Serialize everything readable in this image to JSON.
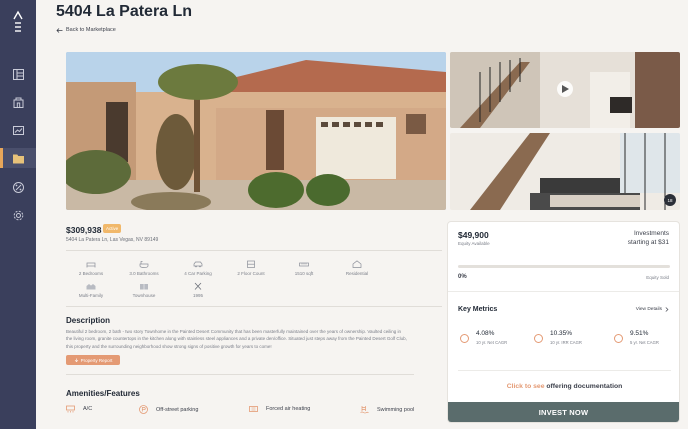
{
  "header": {
    "title": "5404 La Patera Ln",
    "back_label": "Back to Marketplace"
  },
  "sidebar": {
    "items": [
      {
        "icon": "layout-icon"
      },
      {
        "icon": "building-icon"
      },
      {
        "icon": "chart-icon"
      },
      {
        "icon": "folder-icon",
        "active": true
      },
      {
        "icon": "percent-icon"
      },
      {
        "icon": "gear-icon"
      }
    ]
  },
  "gallery": {
    "photo_count": "18"
  },
  "listing": {
    "price": "$309,938",
    "status": "Active",
    "address": "5404 La Patera Ln, Las Vegas, NV 89149",
    "features": [
      {
        "icon": "bed-icon",
        "label": "2 Bedrooms"
      },
      {
        "icon": "bath-icon",
        "label": "3.0 Bathrooms"
      },
      {
        "icon": "car-icon",
        "label": "4 Car Parking"
      },
      {
        "icon": "floor-icon",
        "label": "2 Floor Count"
      },
      {
        "icon": "ruler-icon",
        "label": "1510 sqft"
      },
      {
        "icon": "home-icon",
        "label": "Residential"
      },
      {
        "icon": "multifamily-icon",
        "label": "Multi-Family"
      },
      {
        "icon": "townhouse-icon",
        "label": "Townhouse"
      },
      {
        "icon": "hammer-icon",
        "label": "1995"
      }
    ]
  },
  "description": {
    "title": "Description",
    "text": "Beautiful 2 bedroom, 2 bath - two story Townhome in the Painted Desert Community that has been masterfully maintained over the years of ownership. Vaulted ceiling in the living room, granite countertops in the kitchen along with stainless steel appliances and a private den/office. Situated just steps away from the Painted Desert Golf Club, this property and the surrounding neighborhood show strong signs of positive growth for years to come!",
    "report_label": "Property Report"
  },
  "amenities": {
    "title": "Amenities/Features",
    "items": [
      {
        "icon": "ac-icon",
        "label": "A/C"
      },
      {
        "icon": "parking-icon",
        "label": "Off-street parking"
      },
      {
        "icon": "heater-icon",
        "label": "Forced air heating"
      },
      {
        "icon": "pool-icon",
        "label": "Swimming pool"
      }
    ]
  },
  "investment": {
    "equity_amount": "$49,900",
    "equity_label": "Equity Available",
    "investments_label": "Investments",
    "starting_at": "starting at $31",
    "progress_percent": "0%",
    "progress_value": 0,
    "equity_sold_label": "Equity Sold",
    "key_metrics_title": "Key Metrics",
    "view_details_label": "View Details",
    "metrics": [
      {
        "value": "4.08%",
        "label": "10 yr. Net CAGR"
      },
      {
        "value": "10.35%",
        "label": "10 yr. IRR CAGR"
      },
      {
        "value": "9.51%",
        "label": "5 yr. Net CAGR"
      }
    ],
    "doc_link_prefix": "Click to see",
    "doc_link_suffix": "offering documentation",
    "invest_label": "INVEST NOW"
  },
  "colors": {
    "accent": "#e49a74",
    "sidebar": "#3a3f5c",
    "invest": "#5a6c6c",
    "badge": "#f1b86a"
  }
}
